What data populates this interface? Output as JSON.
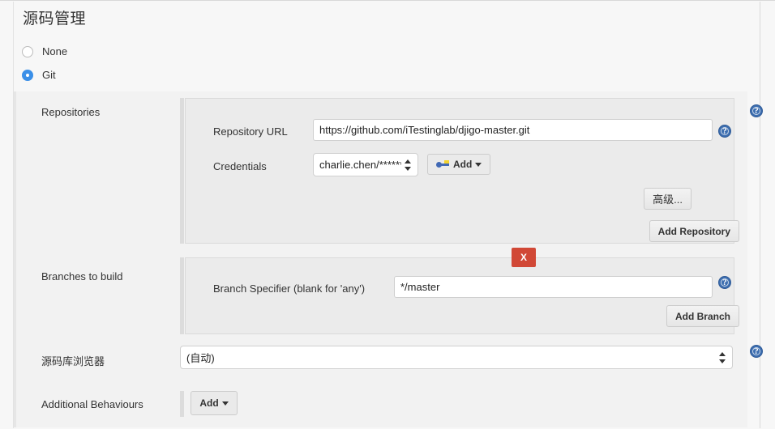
{
  "page": {
    "title": "源码管理"
  },
  "scm": {
    "options": [
      {
        "label": "None",
        "selected": false
      },
      {
        "label": "Git",
        "selected": true
      }
    ]
  },
  "repositories": {
    "label": "Repositories",
    "repository_url": {
      "label": "Repository URL",
      "value": "https://github.com/iTestinglab/djigo-master.git"
    },
    "credentials": {
      "label": "Credentials",
      "value": "charlie.chen/******",
      "add_button": "Add",
      "add_icon": "key-icon"
    },
    "advanced_button": "高级...",
    "add_repository_button": "Add Repository",
    "help_icon": "help-icon"
  },
  "branches": {
    "label": "Branches to build",
    "branch_specifier": {
      "label": "Branch Specifier (blank for 'any')",
      "value": "*/master"
    },
    "delete_button": "X",
    "add_branch_button": "Add Branch",
    "help_icon": "help-icon"
  },
  "repository_browser": {
    "label": "源码库浏览器",
    "value": "(自动)",
    "help_icon": "help-icon"
  },
  "additional_behaviours": {
    "label": "Additional Behaviours",
    "add_button": "Add"
  },
  "colors": {
    "radio_accent": "#3a8fe8",
    "delete_red": "#d14836",
    "help_blue": "#3d6eb0",
    "panel_bg": "#f2f2f2",
    "sub_panel_bg": "#ebebeb"
  }
}
